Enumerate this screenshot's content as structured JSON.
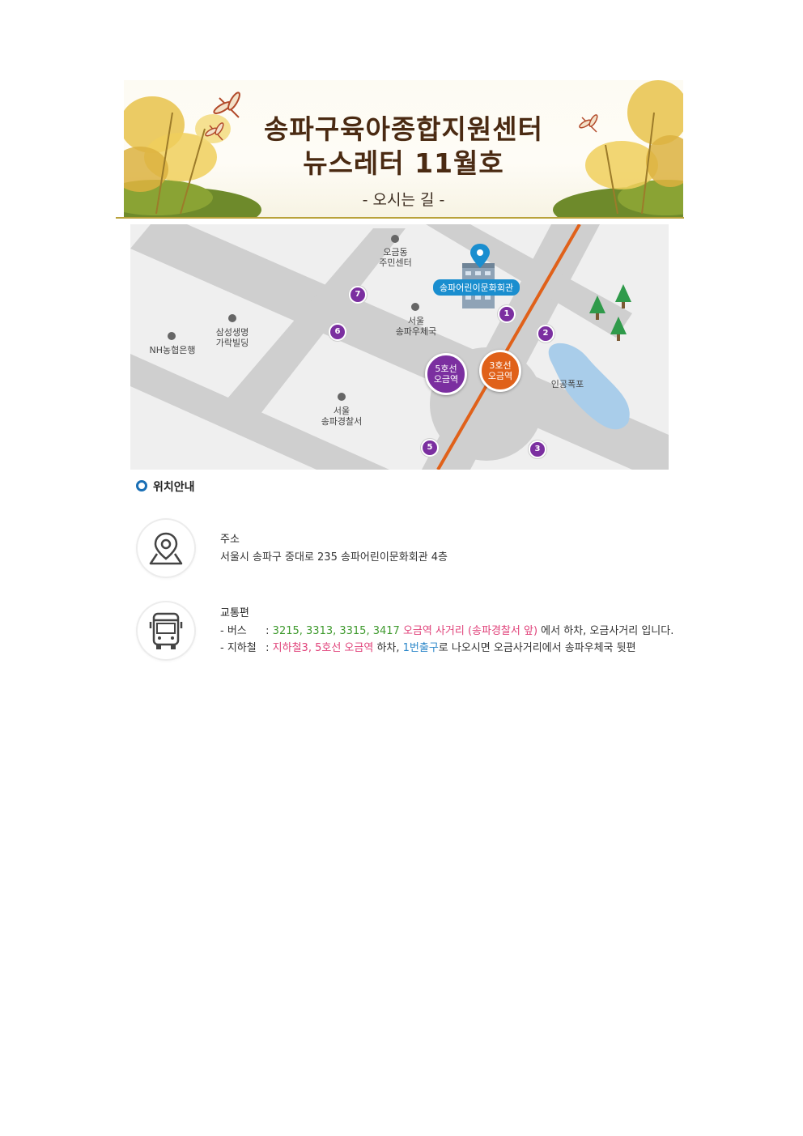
{
  "banner": {
    "title_line1": "송파구육아종합지원센터",
    "title_line2": "뉴스레터 11월호",
    "subtitle": "- 오시는 길 -"
  },
  "map": {
    "building_label": "송파어린이문화회관",
    "places": {
      "community_center": "오금동\n주민센터",
      "post_office": "서울\n송파우체국",
      "samsung_building": "삼성생명\n가락빌딩",
      "nh_bank": "NH농협은행",
      "police_station": "서울\n송파경찰서",
      "waterfall": "인공폭포"
    },
    "stations": {
      "line5": "5호선\n오금역",
      "line3": "3호선\n오금역"
    },
    "exits": [
      "1",
      "2",
      "3",
      "5",
      "6",
      "7"
    ],
    "colors": {
      "line3": "#e0611a",
      "line5": "#7b2fa0",
      "pin": "#1a8ecf",
      "water": "#a9cdea",
      "road": "#cfcfcf"
    }
  },
  "section": {
    "title": "위치안내"
  },
  "address": {
    "icon": "map-pin-icon",
    "title": "주소",
    "text": "서울시 송파구 중대로 235 송파어린이문화회관 4층"
  },
  "transit": {
    "icon": "bus-icon",
    "title": "교통편",
    "bus": {
      "label": "- 버스",
      "sep": ":",
      "routes": "3215, 3313, 3315, 3417",
      "stop": "오금역 사거리 (송파경찰서 앞)",
      "rest": "에서 하차, 오금사거리 입니다."
    },
    "subway": {
      "label": "- 지하철",
      "sep": ":",
      "lines": "지하철3, 5호선 오금역",
      "mid": "하차,",
      "exit": "1번출구",
      "rest": "로 나오시면 오금사거리에서 송파우체국 뒷편"
    }
  }
}
